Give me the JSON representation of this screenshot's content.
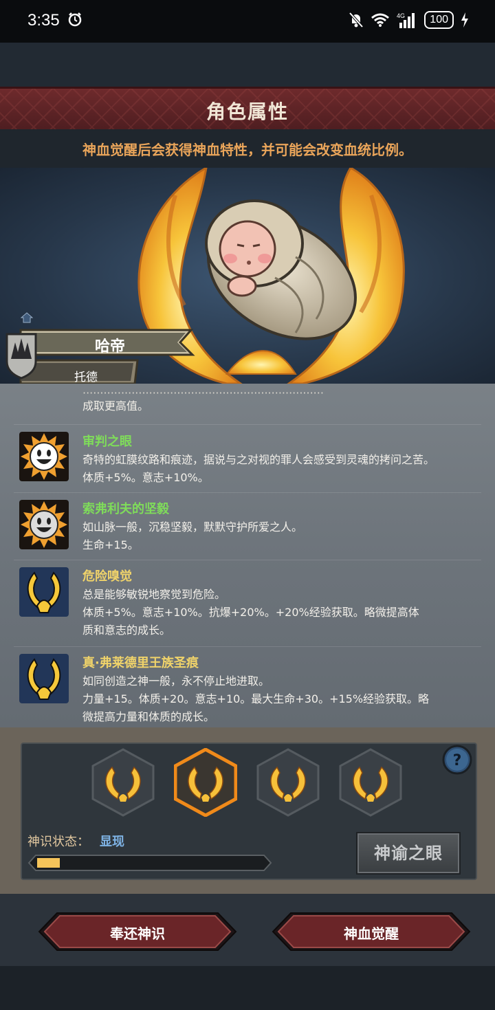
{
  "status_bar": {
    "time": "3:35",
    "network": "4G",
    "battery": "100"
  },
  "header": {
    "title": "角色属性",
    "subtitle": "神血觉醒后会获得神血特性，并可能会改变血统比例。"
  },
  "character": {
    "name": "哈帝",
    "subname": "托德"
  },
  "traits": {
    "partial_line": "成取更高值。",
    "items": [
      {
        "title": "审判之眼",
        "title_color": "#7fdc5a",
        "icon": "smiley-face-icon",
        "desc1": "奇特的虹膜纹路和痕迹，据说与之对视的罪人会感受到灵魂的拷问之苦。",
        "desc2": "体质+5%。意志+10%。"
      },
      {
        "title": "索弗利夫的坚毅",
        "title_color": "#7fdc5a",
        "icon": "smiley-face-icon",
        "desc1": "如山脉一般，沉稳坚毅，默默守护所爱之人。",
        "desc2": "生命+15。"
      },
      {
        "title": "危险嗅觉",
        "title_color": "#f0d36a",
        "icon": "divine-flame-icon",
        "desc1": "总是能够敏锐地察觉到危险。",
        "desc2": "体质+5%。意志+10%。抗爆+20%。+20%经验获取。略微提高体",
        "desc3": "质和意志的成长。"
      },
      {
        "title": "真·弗莱德里王族圣痕",
        "title_color": "#f0d36a",
        "icon": "divine-flame-icon",
        "desc1": "如同创造之神一般，永不停止地进取。",
        "desc2": "力量+15。体质+20。意志+10。最大生命+30。+15%经验获取。略",
        "desc3": "微提高力量和体质的成长。"
      }
    ]
  },
  "divine": {
    "status_label": "神识状态：",
    "status_value": "显现",
    "progress": 0.1,
    "oracle_button": "神谕之眼"
  },
  "actions": {
    "return_label": "奉还神识",
    "awaken_label": "神血觉醒"
  },
  "colors": {
    "accent_orange": "#eaa55a",
    "banner_red": "#6e2a2c",
    "progress_fill": "#f5c45a"
  }
}
